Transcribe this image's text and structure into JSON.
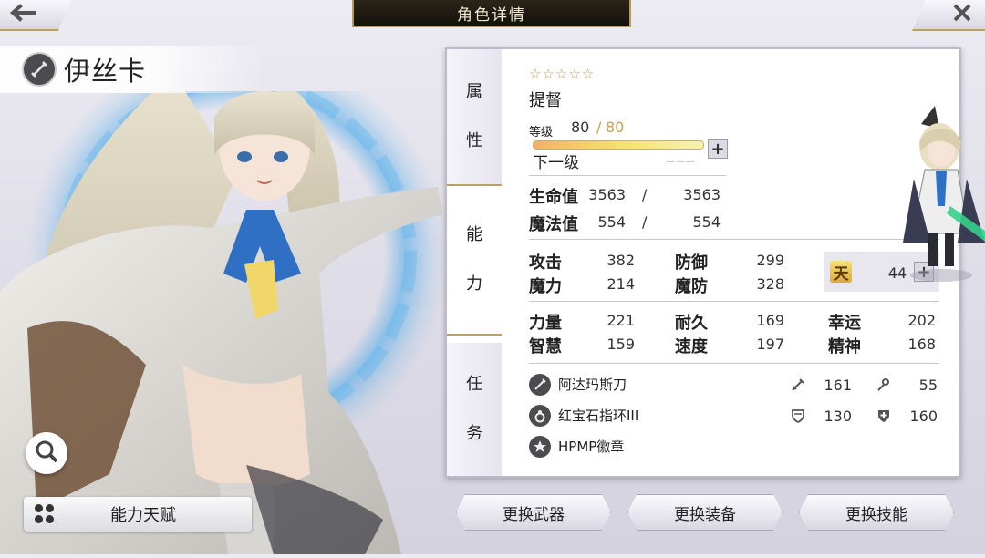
{
  "header": {
    "title": "角色详情",
    "back_icon": "arrow-left-icon",
    "close_icon": "close-x-icon"
  },
  "character": {
    "name": "伊丝卡",
    "weapon_type_icon": "sword-icon"
  },
  "left_actions": {
    "zoom_icon": "magnifier-icon",
    "talent_label": "能力天赋"
  },
  "tabs": [
    {
      "label": "属性",
      "chars": [
        "属",
        "性"
      ]
    },
    {
      "label": "能力",
      "chars": [
        "能",
        "力"
      ],
      "active": true
    },
    {
      "label": "任务",
      "chars": [
        "任",
        "务"
      ]
    }
  ],
  "profile": {
    "stars": "☆☆☆☆☆",
    "rank": "提督",
    "level_label": "等级",
    "level": "80",
    "level_max": "80",
    "xp_fill": 1.0,
    "next_level_label": "下一级",
    "next_level_value": "———"
  },
  "vitals": [
    {
      "label": "生命值",
      "current": "3563",
      "max": "3563"
    },
    {
      "label": "魔法值",
      "current": "554",
      "max": "554"
    }
  ],
  "combat_stats": {
    "attack_label": "攻击",
    "attack": "382",
    "defense_label": "防御",
    "defense": "299",
    "magic_label": "魔力",
    "magic": "214",
    "mdefense_label": "魔防",
    "mdefense": "328"
  },
  "heaven": {
    "glyph": "天",
    "value": "44"
  },
  "attributes": {
    "strength_label": "力量",
    "strength": "221",
    "endurance_label": "耐久",
    "endurance": "169",
    "luck_label": "幸运",
    "luck": "202",
    "wisdom_label": "智慧",
    "wisdom": "159",
    "speed_label": "速度",
    "speed": "197",
    "spirit_label": "精神",
    "spirit": "168"
  },
  "equipment": [
    {
      "name": "阿达玛斯刀",
      "icon": "sword-icon",
      "stat1_icon": "sword-small-icon",
      "stat1": "161",
      "stat2_icon": "wand-icon",
      "stat2": "55"
    },
    {
      "name": "红宝石指环III",
      "icon": "ring-icon",
      "stat1_icon": "shield-icon",
      "stat1": "130",
      "stat2_icon": "shield-plus-icon",
      "stat2": "160"
    },
    {
      "name": "HPMP徽章",
      "icon": "badge-icon"
    }
  ],
  "actions": {
    "change_weapon": "更换武器",
    "change_gear": "更换装备",
    "change_skill": "更换技能"
  },
  "colors": {
    "accent_gold": "#b8a266",
    "level_max": "#c9a04c",
    "panel_bg": "#ffffff"
  }
}
